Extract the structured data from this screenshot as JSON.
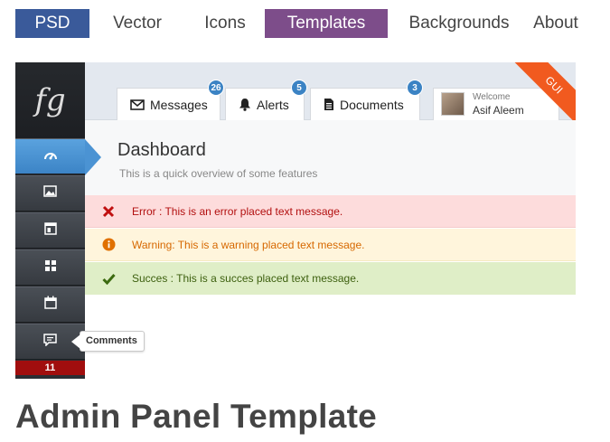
{
  "nav": {
    "items": [
      "PSD",
      "Vector",
      "Icons",
      "Templates",
      "Backgrounds",
      "About"
    ]
  },
  "preview": {
    "logo": "fg",
    "tabs": [
      {
        "label": "Messages",
        "count": "26",
        "icon": "envelope-icon"
      },
      {
        "label": "Alerts",
        "count": "5",
        "icon": "bell-icon"
      },
      {
        "label": "Documents",
        "count": "3",
        "icon": "document-icon"
      }
    ],
    "user": {
      "welcome": "Welcome",
      "name": "Asif Aleem"
    },
    "ribbon": "GUI",
    "dashboard": {
      "title": "Dashboard",
      "subtitle": "This is a quick overview of some features"
    },
    "messages": {
      "error": "Error : This is an error placed text message.",
      "warning": "Warning: This is a warning placed text message.",
      "success": "Succes : This is a succes placed text message."
    },
    "sidebar": {
      "icons": [
        "gauge-icon",
        "image-icon",
        "layout-icon",
        "grid-icon",
        "calendar-icon",
        "comment-icon"
      ],
      "tooltip": "Comments",
      "count": "11"
    }
  },
  "page": {
    "title": "Admin Panel Template"
  },
  "colors": {
    "psd": "#3a5a9a",
    "templates": "#7d4d8a",
    "accent_blue": "#3b83c4",
    "ribbon": "#f15a1f"
  }
}
